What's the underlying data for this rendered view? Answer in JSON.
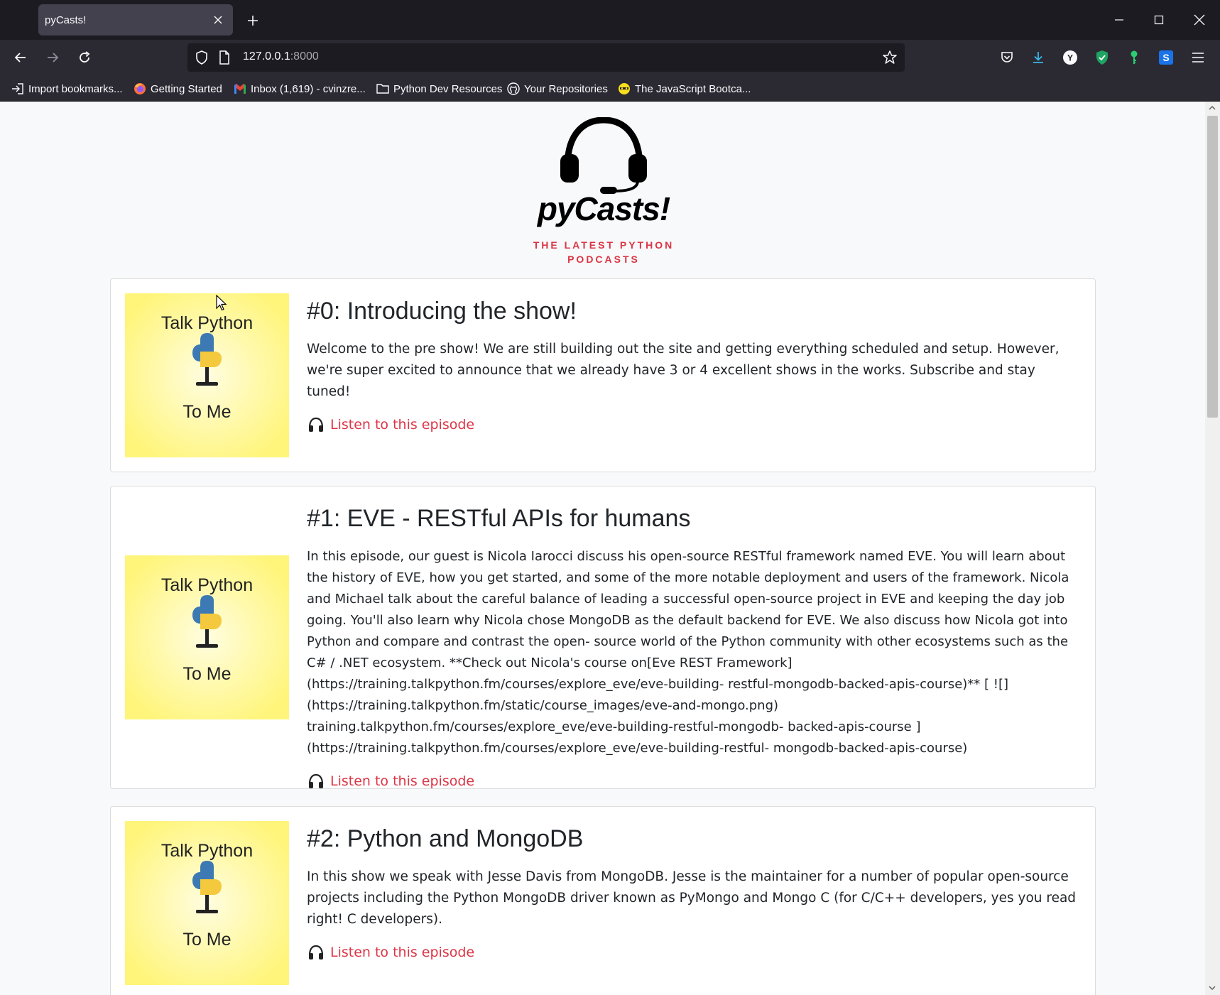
{
  "browser": {
    "tab_title": "pyCasts!",
    "url_host": "127.0.0.1",
    "url_port": ":8000",
    "bookmarks": [
      {
        "label": "Import bookmarks...",
        "icon": "import-icon"
      },
      {
        "label": "Getting Started",
        "icon": "firefox-icon"
      },
      {
        "label": "Inbox (1,619) - cvinzre...",
        "icon": "gmail-icon"
      },
      {
        "label": "Python Dev Resources",
        "icon": "folder-icon"
      },
      {
        "label": "Your Repositories",
        "icon": "github-icon"
      },
      {
        "label": "The JavaScript Bootca...",
        "icon": "bootcamp-icon"
      }
    ],
    "extension_letters": {
      "y": "Y",
      "s": "S"
    }
  },
  "site": {
    "logo_title": "pyCasts!",
    "tagline_line1": "THE LATEST PYTHON",
    "tagline_line2": "PODCASTS"
  },
  "episodes": [
    {
      "title": "#0: Introducing the show!",
      "description": "Welcome to the pre show! We are still building out the site and getting everything scheduled and setup. However, we're super excited to announce that we already have 3 or 4 excellent shows in the works. Subscribe and stay tuned!",
      "listen_label": "Listen to this episode",
      "cover": {
        "line1": "Talk Python",
        "line2": "To Me"
      }
    },
    {
      "title": "#1: EVE - RESTful APIs for humans",
      "description": "In this episode, our guest is Nicola Iarocci discuss his open-source RESTful framework named EVE. You will learn about the history of EVE, how you get started, and some of the more notable deployment and users of the framework. Nicola and Michael talk about the careful balance of leading a successful open-source project in EVE and keeping the day job going. You'll also learn why Nicola chose MongoDB as the default backend for EVE. We also discuss how Nicola got into Python and compare and contrast the open- source world of the Python community with other ecosystems such as the C# / .NET ecosystem. **Check out Nicola's course on[Eve REST Framework](https://training.talkpython.fm/courses/explore_eve/eve-building- restful-mongodb-backed-apis-course)** [ ![](https://training.talkpython.fm/static/course_images/eve-and-mongo.png) training.talkpython.fm/courses/explore_eve/eve-building-restful-mongodb- backed-apis-course ](https://training.talkpython.fm/courses/explore_eve/eve-building-restful- mongodb-backed-apis-course)",
      "listen_label": "Listen to this episode",
      "cover": {
        "line1": "Talk Python",
        "line2": "To Me"
      }
    },
    {
      "title": "#2: Python and MongoDB",
      "description": "In this show we speak with Jesse Davis from MongoDB. Jesse is the maintainer for a number of popular open-source projects including the Python MongoDB driver known as PyMongo and Mongo C (for C/C++ developers, yes you read right! C developers).",
      "listen_label": "Listen to this episode",
      "cover": {
        "line1": "Talk Python",
        "line2": "To Me"
      }
    }
  ],
  "colors": {
    "accent_red": "#dc3545",
    "cover_yellow": "#fff98a",
    "chrome_dark": "#1c1b22"
  }
}
